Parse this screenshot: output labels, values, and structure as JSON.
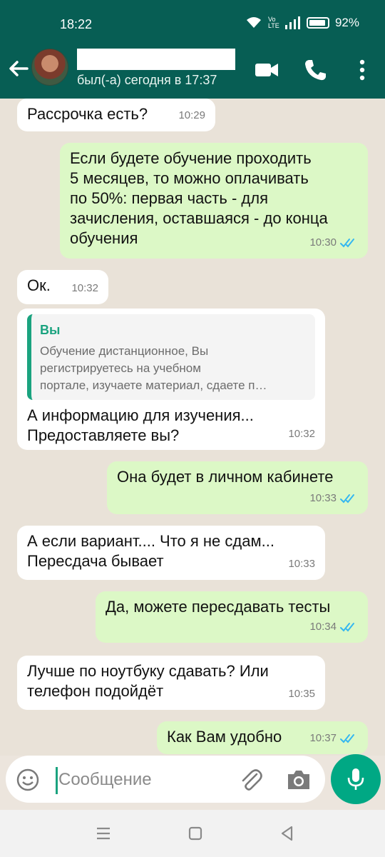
{
  "status_bar": {
    "time": "18:22",
    "battery": "92%",
    "network": "Vo LTE"
  },
  "header": {
    "last_seen": "был(-а) сегодня в 17:37"
  },
  "messages": [
    {
      "dir": "in",
      "text": "Рассрочка есть?",
      "time": "10:29"
    },
    {
      "dir": "out",
      "text": "Если будете обучение проходить\n5 месяцев, то можно оплачивать\nпо 50%: первая часть - для\nзачисления, оставшаяся - до конца\nобучения",
      "time": "10:30",
      "read": true
    },
    {
      "dir": "in",
      "text": "Ок.",
      "time": "10:32"
    },
    {
      "dir": "in",
      "quote_name": "Вы",
      "quote_text": "Обучение дистанционное, Вы\nрегистрируетесь на учебном\nпортале, изучаете материал, сдаете п…",
      "text": "А информацию для изучения...\nПредоставляете вы?",
      "time": "10:32"
    },
    {
      "dir": "out",
      "text": "Она будет в личном кабинете",
      "time": "10:33",
      "read": true
    },
    {
      "dir": "in",
      "text": "А если вариант.... Что я не сдам...\nПересдача бывает",
      "time": "10:33"
    },
    {
      "dir": "out",
      "text": "Да, можете пересдавать тесты",
      "time": "10:34",
      "read": true
    },
    {
      "dir": "in",
      "text": "Лучше по ноутбуку сдавать? Или\nтелефон подойдёт",
      "time": "10:35"
    },
    {
      "dir": "out",
      "text": "Как Вам удобно",
      "time": "10:37",
      "read": true
    }
  ],
  "input": {
    "placeholder": "Сообщение"
  },
  "colors": {
    "header": "#075e54",
    "accent": "#00a884",
    "outgoing": "#dcf8c6",
    "incoming": "#ffffff",
    "read_ticks": "#34b7f1"
  },
  "icons": [
    "back-arrow-icon",
    "video-call-icon",
    "phone-icon",
    "menu-icon",
    "emoji-icon",
    "attach-icon",
    "camera-icon",
    "mic-icon"
  ]
}
